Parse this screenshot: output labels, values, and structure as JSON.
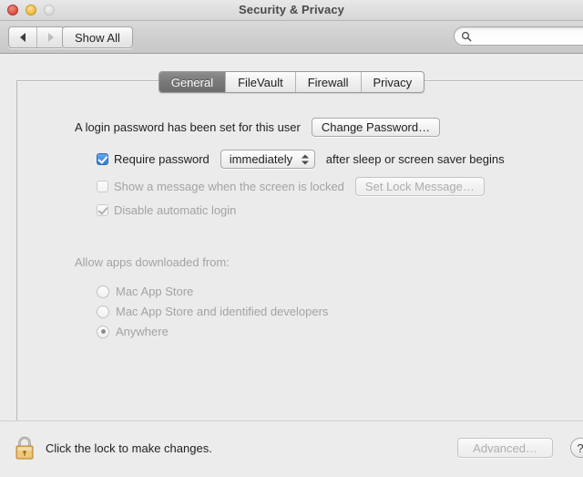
{
  "window": {
    "title": "Security & Privacy",
    "traffic_lights": [
      {
        "name": "close",
        "state": "enabled"
      },
      {
        "name": "minimize",
        "state": "enabled"
      },
      {
        "name": "zoom",
        "state": "disabled"
      }
    ]
  },
  "toolbar": {
    "back_icon": "left-triangle-icon",
    "forward_icon": "right-triangle-icon",
    "show_all_label": "Show All",
    "search": {
      "icon": "search-icon",
      "value": "",
      "placeholder": ""
    }
  },
  "tabs": [
    {
      "label": "General",
      "selected": true
    },
    {
      "label": "FileVault",
      "selected": false
    },
    {
      "label": "Firewall",
      "selected": false
    },
    {
      "label": "Privacy",
      "selected": false
    }
  ],
  "general": {
    "login_password_text": "A login password has been set for this user",
    "change_password_label": "Change Password…",
    "require_password": {
      "checked": true,
      "enabled": true,
      "label": "Require password",
      "delay_value": "immediately",
      "trailing_label": "after sleep or screen saver begins"
    },
    "show_message": {
      "checked": false,
      "enabled": false,
      "label": "Show a message when the screen is locked",
      "button_label": "Set Lock Message…"
    },
    "disable_auto_login": {
      "checked": true,
      "enabled": false,
      "label": "Disable automatic login"
    },
    "allow_apps": {
      "heading": "Allow apps downloaded from:",
      "options": [
        {
          "label": "Mac App Store",
          "selected": false
        },
        {
          "label": "Mac App Store and identified developers",
          "selected": false
        },
        {
          "label": "Anywhere",
          "selected": true
        }
      ]
    }
  },
  "bottom": {
    "lock_icon": "lock-closed-icon",
    "lock_text": "Click the lock to make changes.",
    "advanced_label": "Advanced…",
    "advanced_enabled": false,
    "help_label": "?"
  },
  "colors": {
    "accent_checkbox": "#2f7fd8",
    "tab_selected_bg": "#787878",
    "window_bg": "#ececec",
    "panel_bg": "#ebebeb",
    "lock_body": "#e6b košic"
  }
}
